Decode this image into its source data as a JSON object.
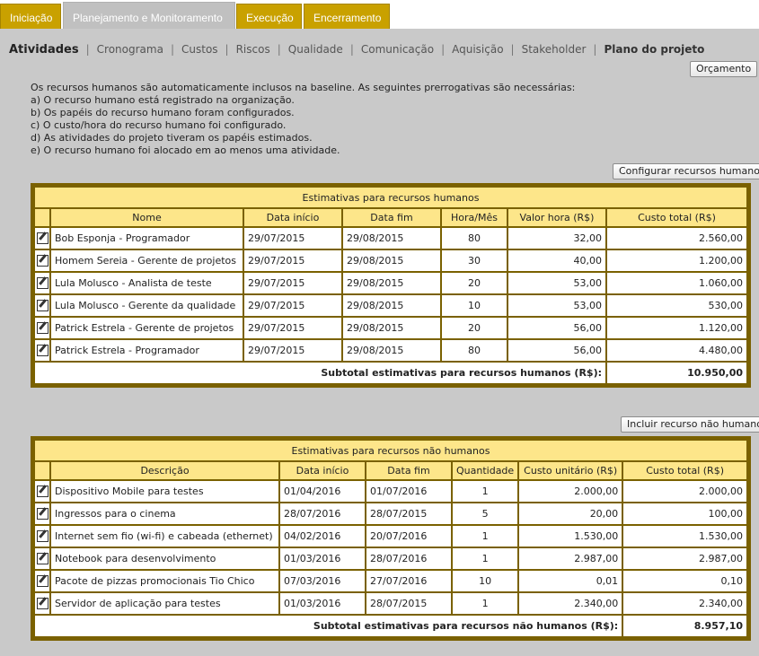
{
  "tabs": [
    "Iniciação",
    "Planejamento e Monitoramento",
    "Execução",
    "Encerramento"
  ],
  "subnav": [
    "Atividades",
    "Cronograma",
    "Custos",
    "Riscos",
    "Qualidade",
    "Comunicação",
    "Aquisição",
    "Stakeholder",
    "Plano do projeto"
  ],
  "buttons": {
    "orcamento": "Orçamento",
    "configurar": "Configurar recursos humanos",
    "incluir": "Incluir recurso não humano"
  },
  "info": [
    "Os recursos humanos são automaticamente inclusos na baseline. As seguintes prerrogativas são necessárias:",
    "a) O recurso humano está registrado na organização.",
    "b) Os papéis do recurso humano foram configurados.",
    "c) O custo/hora do recurso humano foi configurado.",
    "d) As atividades do projeto tiveram os papéis estimados.",
    "e) O recurso humano foi alocado em ao menos uma atividade."
  ],
  "hr": {
    "title": "Estimativas para recursos humanos",
    "headers": [
      "Nome",
      "Data início",
      "Data fim",
      "Hora/Mês",
      "Valor hora  (R$)",
      "Custo total  (R$)"
    ],
    "rows": [
      [
        "Bob Esponja - Programador",
        "29/07/2015",
        "29/08/2015",
        "80",
        "32,00",
        "2.560,00"
      ],
      [
        "Homem Sereia - Gerente de projetos",
        "29/07/2015",
        "29/08/2015",
        "30",
        "40,00",
        "1.200,00"
      ],
      [
        "Lula Molusco - Analista de teste",
        "29/07/2015",
        "29/08/2015",
        "20",
        "53,00",
        "1.060,00"
      ],
      [
        "Lula Molusco - Gerente da qualidade",
        "29/07/2015",
        "29/08/2015",
        "10",
        "53,00",
        "530,00"
      ],
      [
        "Patrick Estrela - Gerente de projetos",
        "29/07/2015",
        "29/08/2015",
        "20",
        "56,00",
        "1.120,00"
      ],
      [
        "Patrick Estrela - Programador",
        "29/07/2015",
        "29/08/2015",
        "80",
        "56,00",
        "4.480,00"
      ]
    ],
    "subtotal_label": "Subtotal estimativas para recursos humanos  (R$):",
    "subtotal_value": "10.950,00"
  },
  "nhr": {
    "title": "Estimativas para recursos não humanos",
    "headers": [
      "Descrição",
      "Data início",
      "Data fim",
      "Quantidade",
      "Custo unitário  (R$)",
      "Custo total   (R$)"
    ],
    "rows": [
      [
        "Dispositivo Mobile para testes",
        "01/04/2016",
        "01/07/2016",
        "1",
        "2.000,00",
        "2.000,00"
      ],
      [
        "Ingressos para o cinema",
        "28/07/2016",
        "28/07/2015",
        "5",
        "20,00",
        "100,00"
      ],
      [
        "Internet sem fio (wi-fi) e cabeada (ethernet)",
        "04/02/2016",
        "20/07/2016",
        "1",
        "1.530,00",
        "1.530,00"
      ],
      [
        "Notebook para desenvolvimento",
        "01/03/2016",
        "28/07/2016",
        "1",
        "2.987,00",
        "2.987,00"
      ],
      [
        "Pacote de pizzas promocionais Tio Chico",
        "07/03/2016",
        "27/07/2016",
        "10",
        "0,01",
        "0,10"
      ],
      [
        "Servidor de aplicação para testes",
        "01/03/2016",
        "28/07/2015",
        "1",
        "2.340,00",
        "2.340,00"
      ]
    ],
    "subtotal_label": "Subtotal estimativas para recursos não humanos  (R$):",
    "subtotal_value": "8.957,10"
  },
  "icons": {
    "edit": "edit-icon"
  },
  "colors": {
    "tab": "#c9a100",
    "panel_border": "#7a6100",
    "header_bg": "#fde68a",
    "content_bg": "#c9c9c9"
  }
}
